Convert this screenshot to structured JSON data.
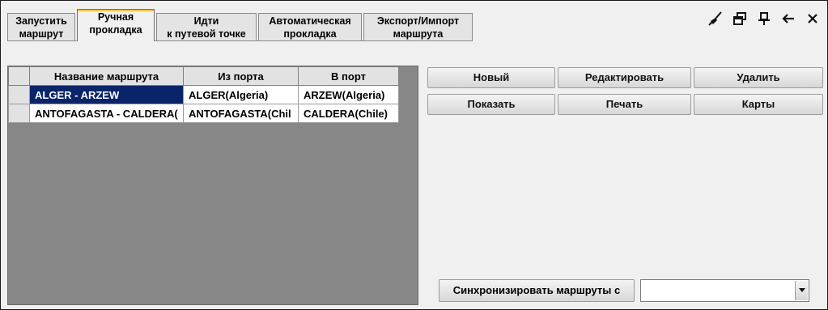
{
  "tabs": [
    {
      "line1": "Запустить",
      "line2": "маршрут",
      "active": false
    },
    {
      "line1": "Ручная",
      "line2": "прокладка",
      "active": true
    },
    {
      "line1": "Идти",
      "line2": "к путевой точке",
      "active": false
    },
    {
      "line1": "Автоматическая",
      "line2": "прокладка",
      "active": false
    },
    {
      "line1": "Экспорт/Импорт",
      "line2": "маршрута",
      "active": false
    }
  ],
  "toolbar": {
    "icons": [
      "brush-icon",
      "restore-window-icon",
      "pin-icon",
      "back-arrow-icon",
      "close-icon"
    ]
  },
  "table": {
    "columns": [
      "Название маршрута",
      "Из порта",
      "В порт"
    ],
    "rows": [
      [
        "ALGER - ARZEW",
        "ALGER(Algeria)",
        "ARZEW(Algeria)"
      ],
      [
        "ANTOFAGASTA - CALDERA(",
        "ANTOFAGASTA(Chil",
        "CALDERA(Chile)"
      ]
    ],
    "selected_row": 0
  },
  "actions": {
    "new": "Новый",
    "edit": "Редактировать",
    "delete": "Удалить",
    "show": "Показать",
    "print": "Печать",
    "maps": "Карты"
  },
  "sync": {
    "button_label": "Синхронизировать маршруты с",
    "selected_value": ""
  },
  "colors": {
    "selection": "#0a246a",
    "grid_empty": "#878787",
    "panel": "#f0f0f0"
  }
}
